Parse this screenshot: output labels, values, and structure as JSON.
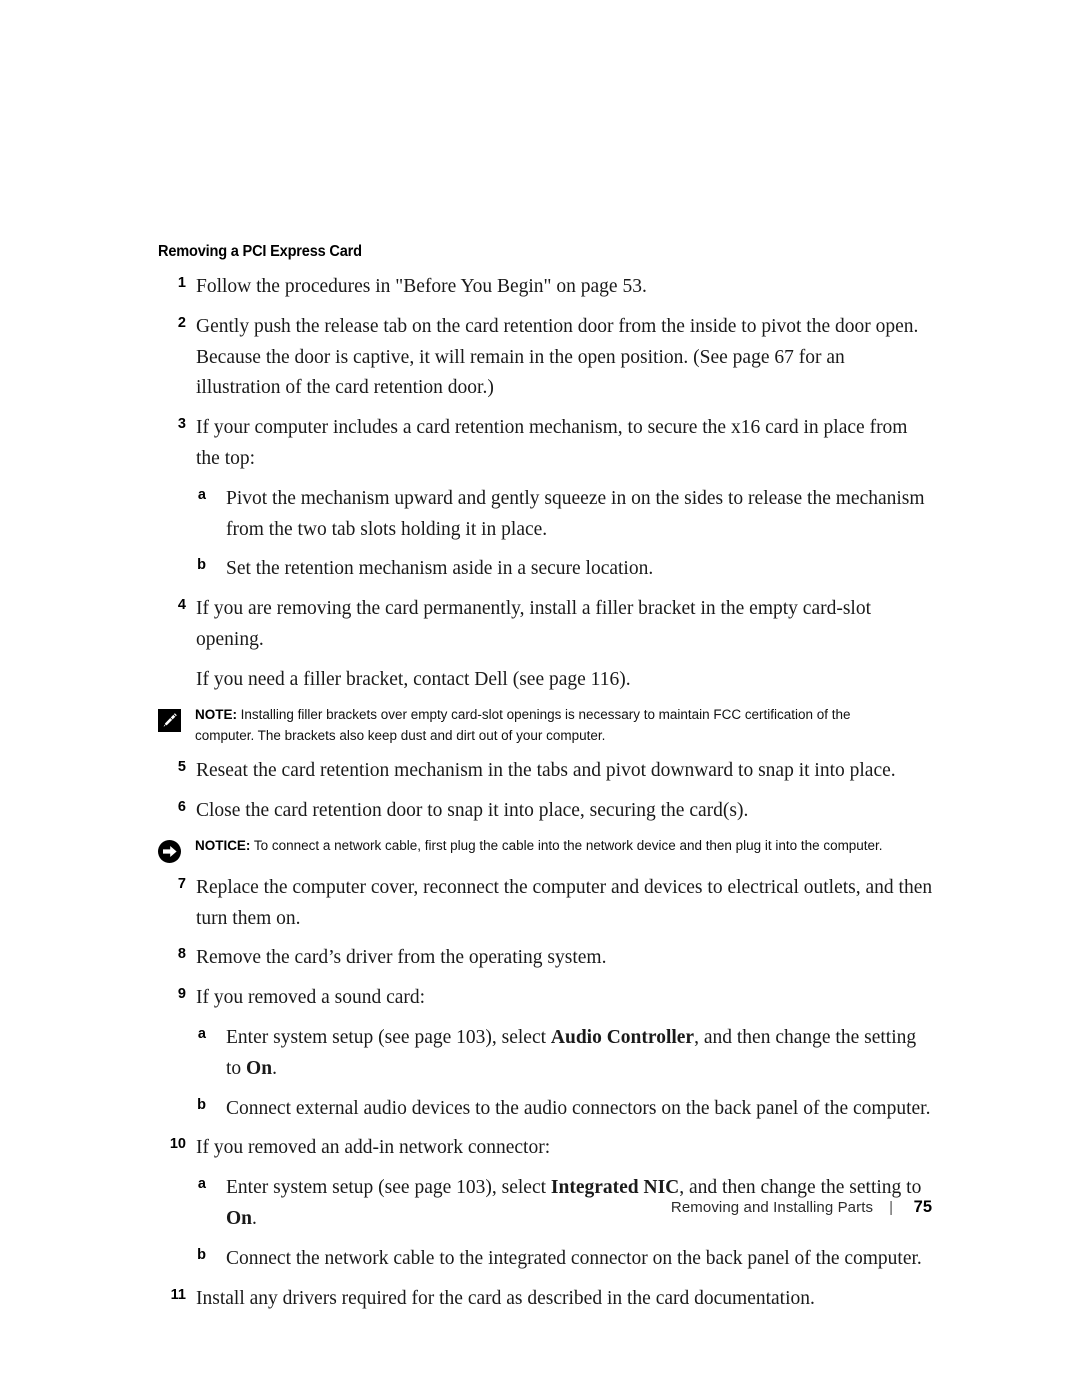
{
  "document": {
    "section_heading": "Removing a PCI Express Card",
    "steps": [
      {
        "level": 1,
        "marker": "1",
        "parts": [
          {
            "text": "Follow the procedures in \"Before You Begin\" on page 53.",
            "bold": false
          }
        ]
      },
      {
        "level": 1,
        "marker": "2",
        "parts": [
          {
            "text": "Gently push the release tab on the card retention door from the inside to pivot the door open. Because the door is captive, it will remain in the open position. (See page 67 for an illustration of the card retention door.)",
            "bold": false
          }
        ]
      },
      {
        "level": 1,
        "marker": "3",
        "parts": [
          {
            "text": "If your computer includes a card retention mechanism, to secure the x16 card in place from the top:",
            "bold": false
          }
        ]
      },
      {
        "level": 2,
        "marker": "a",
        "parts": [
          {
            "text": "Pivot the mechanism upward and gently squeeze in on the sides to release the mechanism from the two tab slots holding it in place.",
            "bold": false
          }
        ]
      },
      {
        "level": 2,
        "marker": "b",
        "parts": [
          {
            "text": "Set the retention mechanism aside in a secure location.",
            "bold": false
          }
        ]
      },
      {
        "level": 1,
        "marker": "4",
        "parts": [
          {
            "text": "If you are removing the card permanently, install a filler bracket in the empty card-slot opening.",
            "bold": false
          }
        ],
        "continuation": "If you need a filler bracket, contact Dell (see page 116)."
      },
      {
        "level": 1,
        "marker": "5",
        "parts": [
          {
            "text": "Reseat the card retention mechanism in the tabs and pivot downward to snap it into place.",
            "bold": false
          }
        ]
      },
      {
        "level": 1,
        "marker": "6",
        "parts": [
          {
            "text": "Close the card retention door to snap it into place, securing the card(s).",
            "bold": false
          }
        ]
      },
      {
        "level": 1,
        "marker": "7",
        "parts": [
          {
            "text": "Replace the computer cover, reconnect the computer and devices to electrical outlets, and then turn them on.",
            "bold": false
          }
        ]
      },
      {
        "level": 1,
        "marker": "8",
        "parts": [
          {
            "text": "Remove the card’s driver from the operating system.",
            "bold": false
          }
        ]
      },
      {
        "level": 1,
        "marker": "9",
        "parts": [
          {
            "text": "If you removed a sound card:",
            "bold": false
          }
        ]
      },
      {
        "level": 2,
        "marker": "a",
        "parts": [
          {
            "text": "Enter system setup (see page 103), select ",
            "bold": false
          },
          {
            "text": "Audio Controller",
            "bold": true
          },
          {
            "text": ", and then change the setting to ",
            "bold": false
          },
          {
            "text": "On",
            "bold": true
          },
          {
            "text": ".",
            "bold": false
          }
        ]
      },
      {
        "level": 2,
        "marker": "b",
        "parts": [
          {
            "text": "Connect external audio devices to the audio connectors on the back panel of the computer.",
            "bold": false
          }
        ]
      },
      {
        "level": 1,
        "marker": "10",
        "parts": [
          {
            "text": "If you removed an add-in network connector:",
            "bold": false
          }
        ]
      },
      {
        "level": 2,
        "marker": "a",
        "parts": [
          {
            "text": "Enter system setup (see page 103), select ",
            "bold": false
          },
          {
            "text": "Integrated NIC",
            "bold": true
          },
          {
            "text": ", and then change the setting to ",
            "bold": false
          },
          {
            "text": "On",
            "bold": true
          },
          {
            "text": ".",
            "bold": false
          }
        ]
      },
      {
        "level": 2,
        "marker": "b",
        "parts": [
          {
            "text": "Connect the network cable to the integrated connector on the back panel of the computer.",
            "bold": false
          }
        ]
      },
      {
        "level": 1,
        "marker": "11",
        "parts": [
          {
            "text": "Install any drivers required for the card as described in the card documentation.",
            "bold": false
          }
        ]
      }
    ],
    "callouts": {
      "note": {
        "icon": "note-pencil-icon",
        "label": "NOTE:",
        "text": " Installing filler brackets over empty card-slot openings is necessary to maintain FCC certification of the computer. The brackets also keep dust and dirt out of your computer."
      },
      "notice": {
        "icon": "notice-arrow-icon",
        "label": "NOTICE:",
        "text": " To connect a network cable, first plug the cable into the network device and then plug it into the computer."
      }
    },
    "footer": {
      "title": "Removing and Installing Parts",
      "separator": "|",
      "page_number": "75"
    },
    "colors": {
      "text": "#1a1a1a",
      "heading": "#000000",
      "icon": "#000000",
      "background": "#ffffff"
    }
  }
}
